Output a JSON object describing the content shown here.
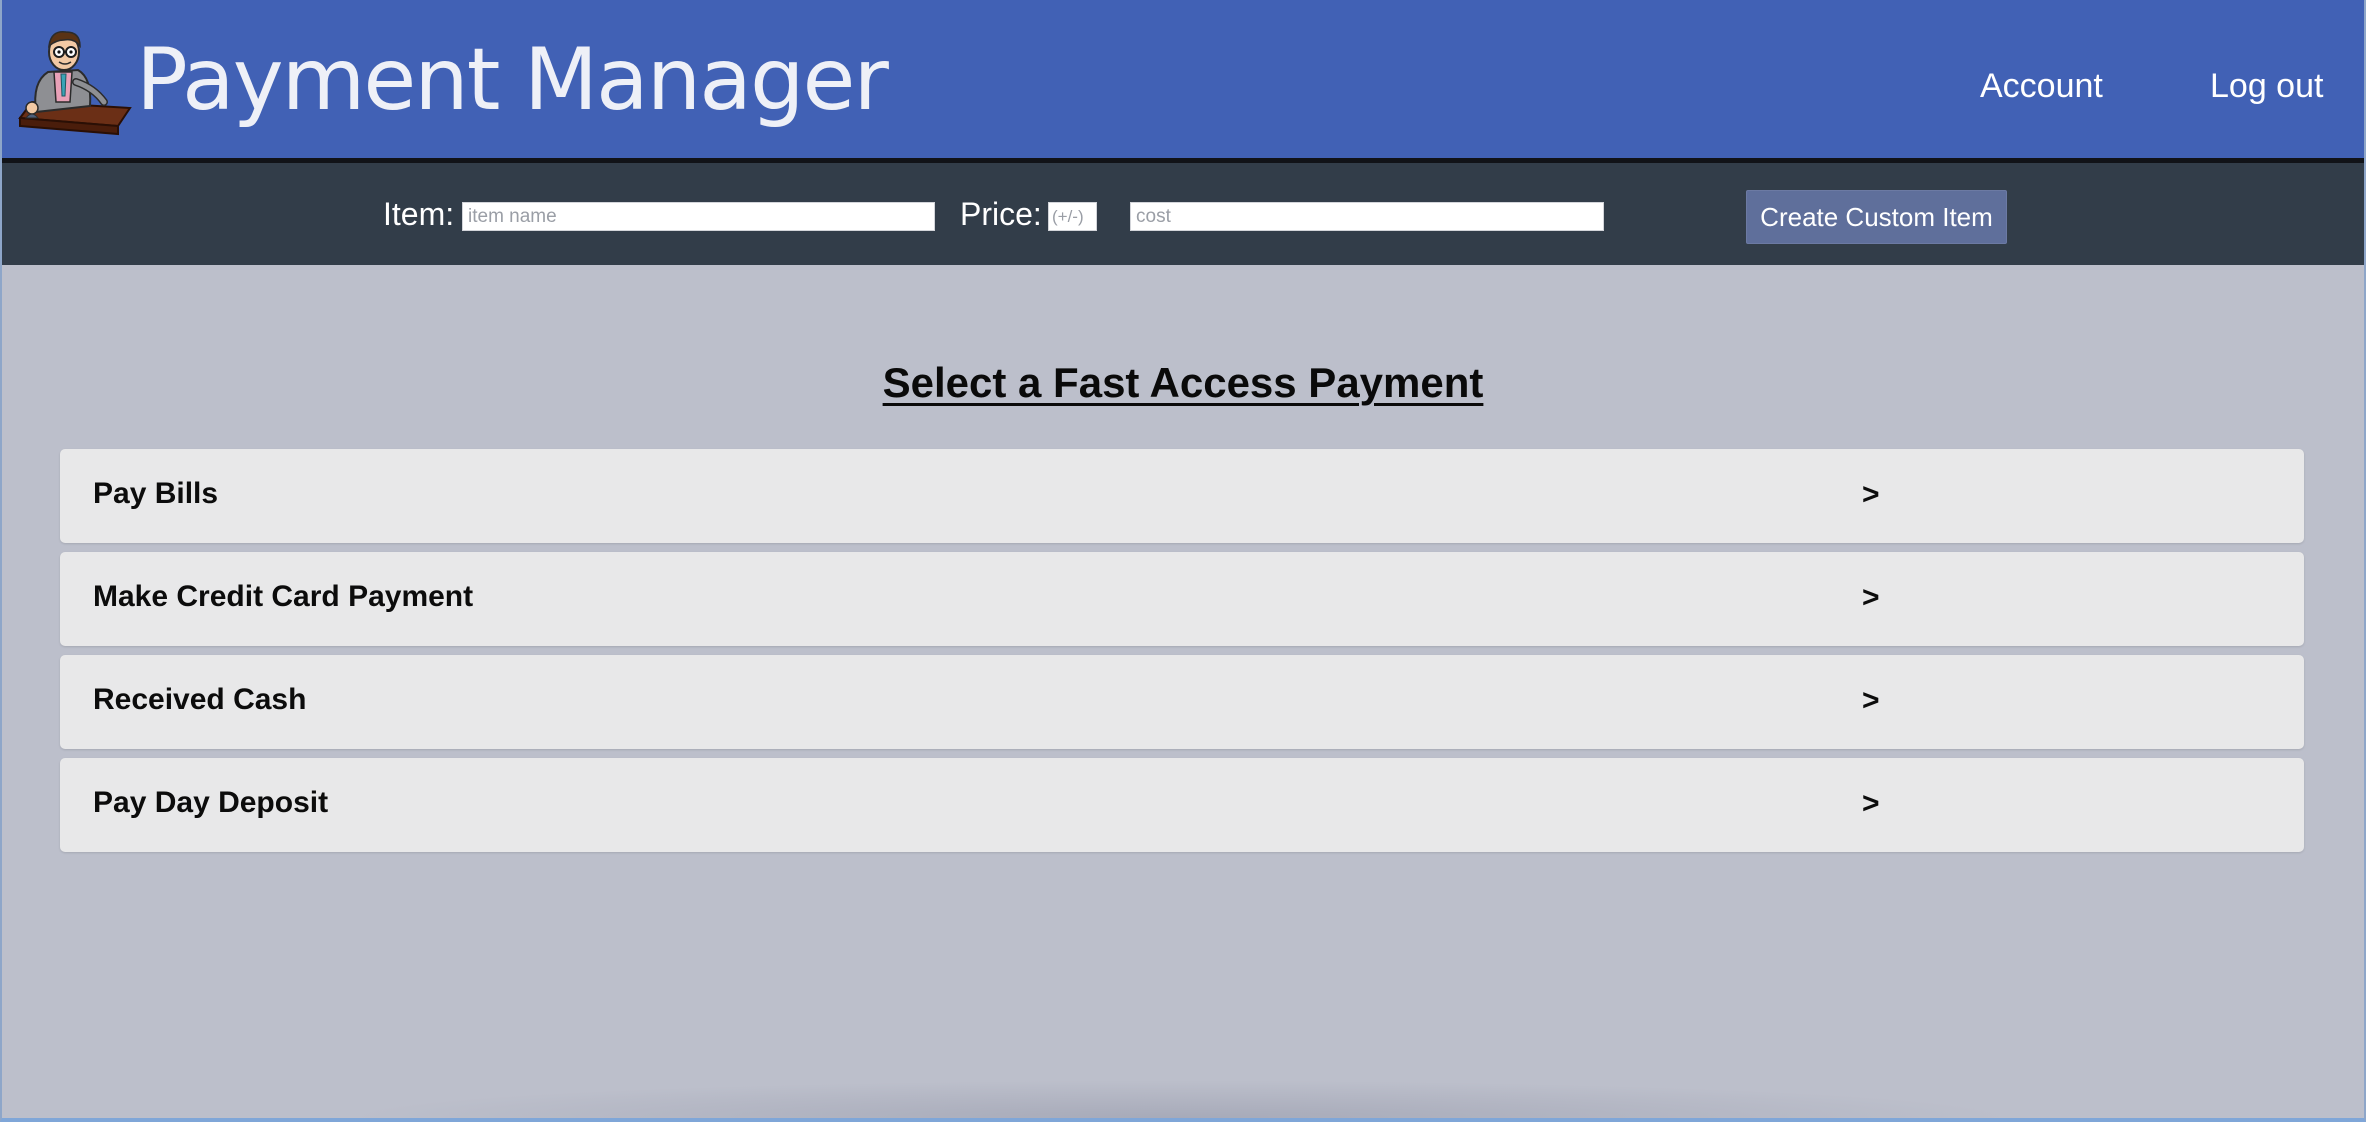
{
  "header": {
    "title": "Payment Manager",
    "logo_icon": "cartoon-clerk-logo-icon",
    "nav": {
      "account_label": "Account",
      "logout_label": "Log out"
    },
    "background_color": "#4161b5"
  },
  "toolbar": {
    "item_label": "Item:",
    "item_placeholder": "item name",
    "item_value": "",
    "price_label": "Price:",
    "sign_placeholder": "(+/-)",
    "sign_value": "",
    "cost_placeholder": "cost",
    "cost_value": "",
    "create_button_label": "Create Custom Item",
    "background_color": "#323d49",
    "button_color": "#5f6f9b"
  },
  "main": {
    "section_title": "Select a Fast Access Payment",
    "payments": [
      {
        "label": "Pay Bills",
        "arrow": ">"
      },
      {
        "label": "Make Credit Card Payment",
        "arrow": ">"
      },
      {
        "label": "Received Cash",
        "arrow": ">"
      },
      {
        "label": "Pay Day Deposit",
        "arrow": ">"
      }
    ],
    "background_color": "#bcbfcb",
    "item_background_color": "#e8e8e9"
  }
}
